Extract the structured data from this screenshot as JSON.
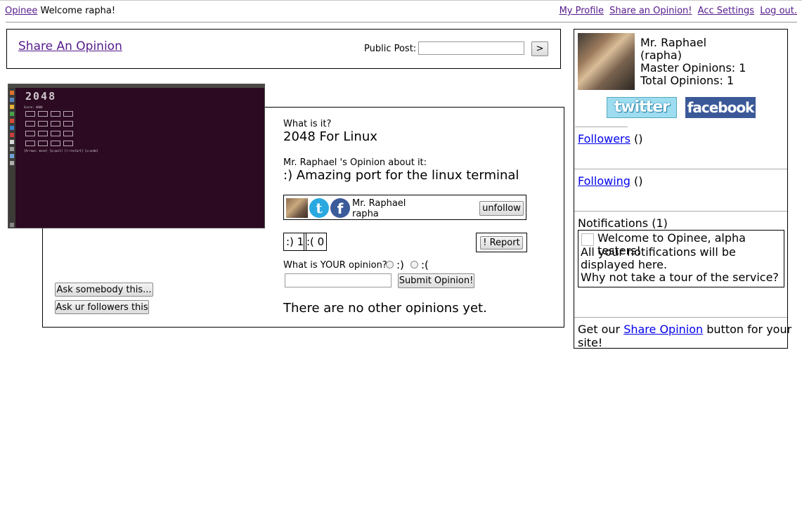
{
  "topbar": {
    "brand": "Opinee",
    "welcome": "Welcome rapha!",
    "links": [
      "My Profile",
      "Share an Opinion!",
      "Acc Settings",
      "Log out."
    ]
  },
  "share": {
    "title": "Share An Opinion",
    "public_post_label": "Public Post:",
    "public_post_value": "",
    "go_label": ">"
  },
  "thumbnail": {
    "title_text": "2048",
    "score_text": "Score: 4080",
    "footer_text": "[Arrows: move] [q:quit] [r:restart] [u:undo]"
  },
  "opinion": {
    "what_label": "What is it?",
    "what_value": "2048 For Linux",
    "opinion_label": "Mr. Raphael 's Opinion about it:",
    "opinion_value": ":)  Amazing port for the linux terminal",
    "author_name": "Mr. Raphael",
    "author_handle": "rapha",
    "unfollow_label": "unfollow",
    "votes_up": ":) 1",
    "votes_down": ":( 0",
    "report_label": "! Report",
    "your_opinion_label": "What is YOUR opinion?",
    "radio_happy": ":)",
    "radio_sad": ":(",
    "your_opinion_value": "",
    "submit_label": "Submit Opinion!",
    "no_opinions": "There are no other opinions yet.",
    "ask_somebody_label": "Ask somebody this...",
    "ask_followers_label": "Ask ur followers this"
  },
  "profile": {
    "name": "Mr. Raphael",
    "handle": "(rapha)",
    "master_opinions": "Master Opinions: 1",
    "total_opinions": "Total Opinions: 1",
    "twitter_label": "twitter",
    "facebook_label": "facebook"
  },
  "sidebar": {
    "followers_label": "Followers",
    "followers_count": "()",
    "following_label": "Following",
    "following_count": "()",
    "notifications_title": "Notifications (1)",
    "notification_title": "Welcome to Opinee, alpha testers!",
    "notification_body": "All your notifications will be displayed here.\nWhy not take a tour of the service?",
    "get_share_prefix": "Get our ",
    "get_share_link": "Share Opinion",
    "get_share_suffix": " button for your site!"
  },
  "colors": {
    "visited_link": "#551a8b",
    "link": "#0000ee",
    "terminal_bg": "#2c0a22",
    "twitter": "#2aa9e0",
    "facebook": "#3b5998"
  }
}
